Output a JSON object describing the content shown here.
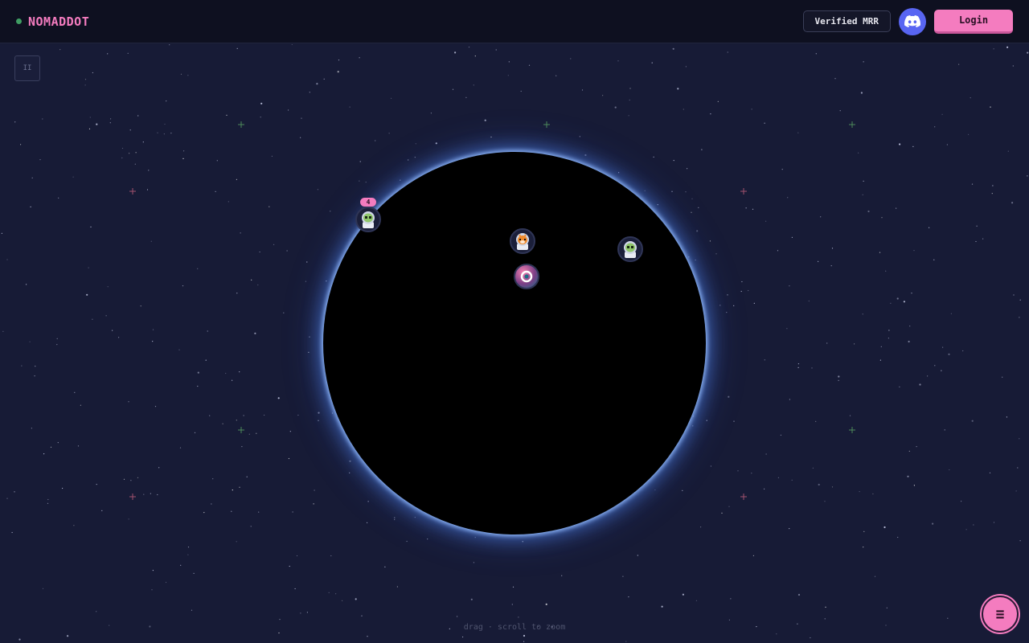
{
  "header": {
    "brand": "NOMADDOT",
    "mrr_label": "Verified MRR",
    "login_label": "Login"
  },
  "canvas": {
    "badge_count": "4",
    "hint": "drag · scroll to zoom",
    "pause_label": "II",
    "menu_label": "≡"
  },
  "icons": [
    "status-dot-icon",
    "discord-icon",
    "pause-icon",
    "menu-icon"
  ],
  "colors": {
    "accent": "#f47cbf",
    "discord": "#5865f2",
    "background": "#171b36",
    "topbar": "#0e1020",
    "planet_glow": "#6a9cf0",
    "status": "#3f9d63"
  }
}
